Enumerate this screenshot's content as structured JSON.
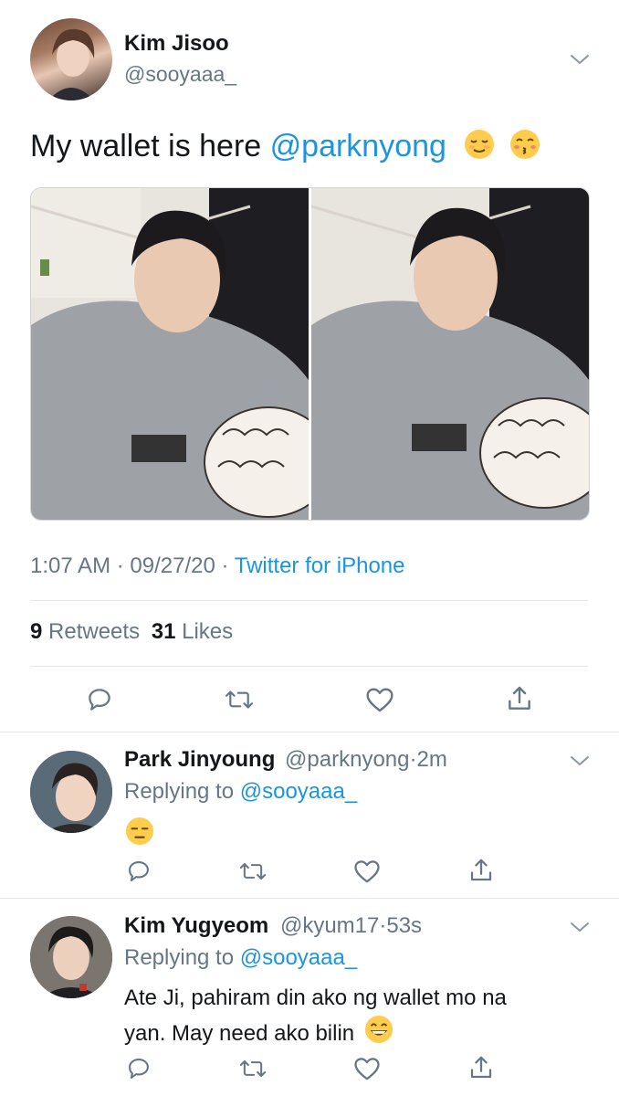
{
  "tweet": {
    "author_name": "Kim Jisoo",
    "author_handle": "@sooyaaa_",
    "text_before": "My wallet is here ",
    "mention": "@parknyong",
    "emojis": [
      "relieved-face",
      "kissing-face-with-closed-eyes"
    ],
    "time": "1:07 AM",
    "date": "09/27/20",
    "separator": "·",
    "source": "Twitter for iPhone",
    "retweet_count": "9",
    "retweet_label": "Retweets",
    "like_count": "31",
    "like_label": "Likes",
    "image_count": 2
  },
  "replies": [
    {
      "name": "Park Jinyoung",
      "handle": "@parknyong",
      "dot": "·",
      "time": "2m",
      "replying_label": "Replying to",
      "replying_to": "@sooyaaa_",
      "emoji": "expressionless-face",
      "text": ""
    },
    {
      "name": "Kim Yugyeom",
      "handle": "@kyum17",
      "dot": "·",
      "time": "53s",
      "replying_label": "Replying to",
      "replying_to": "@sooyaaa_",
      "text_line1": "Ate Ji, pahiram din ako ng wallet mo na",
      "text_line2": "yan. May need ako bilin",
      "emoji": "grinning-face"
    }
  ],
  "colors": {
    "link": "#1b95e0",
    "secondary": "#657786",
    "divider": "#e1e8ed",
    "primary": "#14171a"
  }
}
